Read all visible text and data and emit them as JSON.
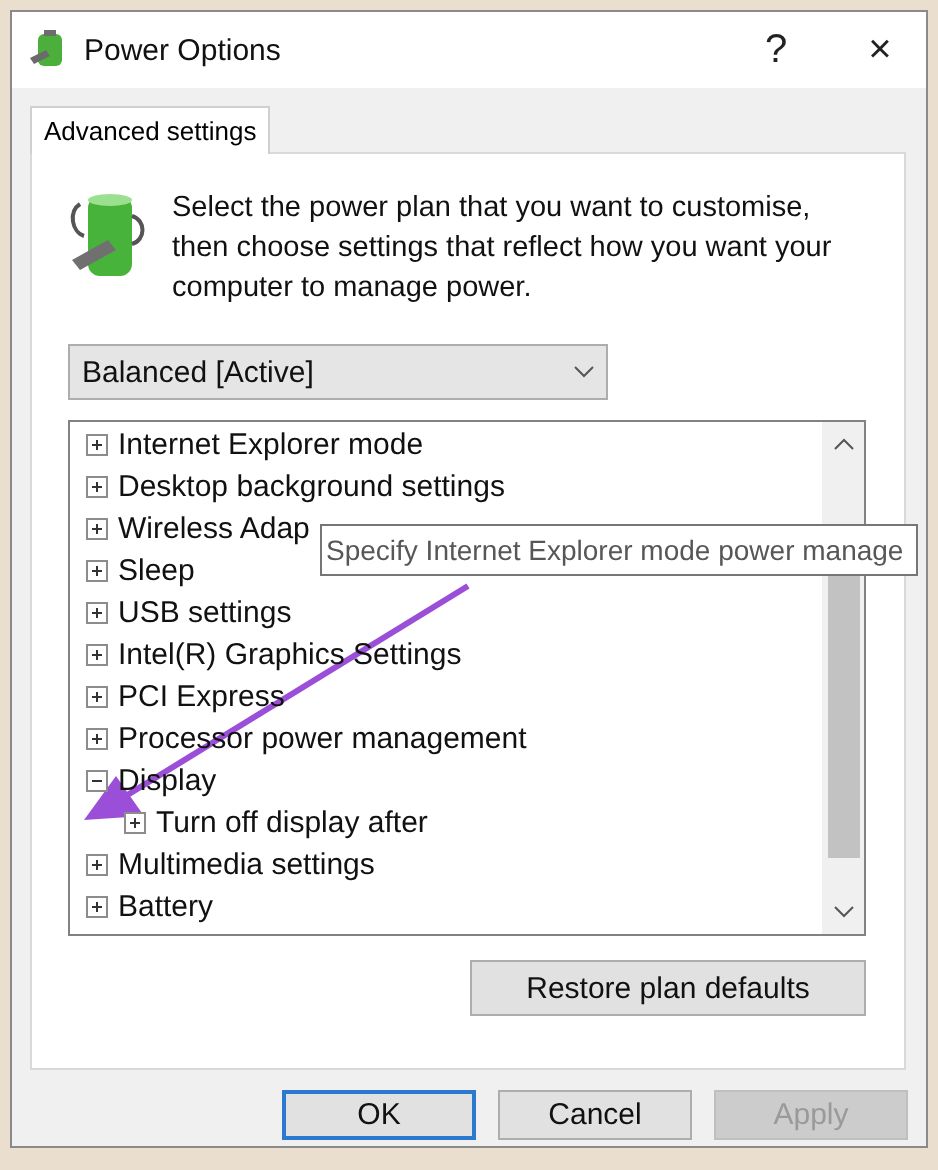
{
  "window": {
    "title": "Power Options",
    "help": "?",
    "close": "×"
  },
  "tabs": [
    {
      "label": "Advanced settings",
      "selected": true
    }
  ],
  "intro": "Select the power plan that you want to customise, then choose settings that reflect how you want your computer to manage power.",
  "plan_dropdown": {
    "value": "Balanced [Active]"
  },
  "tree": {
    "items": [
      {
        "label": "Internet Explorer mode",
        "expanded": false
      },
      {
        "label": "Desktop background settings",
        "expanded": false
      },
      {
        "label": "Wireless Adap",
        "expanded": false
      },
      {
        "label": "Sleep",
        "expanded": false
      },
      {
        "label": "USB settings",
        "expanded": false
      },
      {
        "label": "Intel(R) Graphics Settings",
        "expanded": false
      },
      {
        "label": "PCI Express",
        "expanded": false
      },
      {
        "label": "Processor power management",
        "expanded": false
      },
      {
        "label": "Display",
        "expanded": true,
        "children": [
          {
            "label": "Turn off display after",
            "expanded": false
          }
        ]
      },
      {
        "label": "Multimedia settings",
        "expanded": false
      },
      {
        "label": "Battery",
        "expanded": false
      }
    ]
  },
  "tooltip": "Specify Internet Explorer mode power manage",
  "restore_button": "Restore plan defaults",
  "buttons": [
    {
      "label": "OK",
      "default": true,
      "disabled": false
    },
    {
      "label": "Cancel",
      "default": false,
      "disabled": false
    },
    {
      "label": "Apply",
      "default": false,
      "disabled": true
    }
  ]
}
